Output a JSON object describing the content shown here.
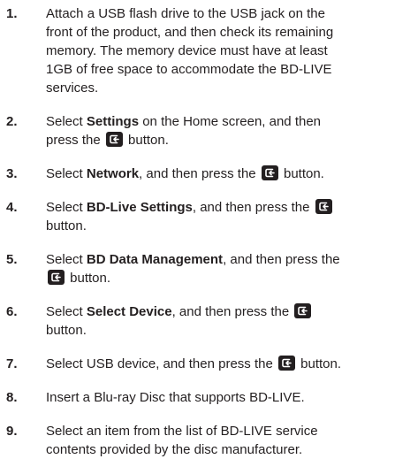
{
  "steps": [
    {
      "number": "1.",
      "segments": [
        {
          "t": "text",
          "v": "Attach a USB flash drive to the USB jack on the\nfront of the product, and then check its remaining\nmemory. The memory device must have at least\n1GB of free space to accommodate the BD-LIVE\nservices."
        }
      ]
    },
    {
      "number": "2.",
      "segments": [
        {
          "t": "text",
          "v": "Select "
        },
        {
          "t": "bold",
          "v": "Settings"
        },
        {
          "t": "text",
          "v": " on the Home screen, and then\npress the "
        },
        {
          "t": "icon",
          "v": "enter-button-icon"
        },
        {
          "t": "text",
          "v": " button."
        }
      ]
    },
    {
      "number": "3.",
      "segments": [
        {
          "t": "text",
          "v": "Select "
        },
        {
          "t": "bold",
          "v": "Network"
        },
        {
          "t": "text",
          "v": ", and then press the "
        },
        {
          "t": "icon",
          "v": "enter-button-icon"
        },
        {
          "t": "text",
          "v": " button."
        }
      ]
    },
    {
      "number": "4.",
      "segments": [
        {
          "t": "text",
          "v": "Select "
        },
        {
          "t": "bold",
          "v": "BD-Live Settings"
        },
        {
          "t": "text",
          "v": ", and then press the "
        },
        {
          "t": "icon",
          "v": "enter-button-icon"
        },
        {
          "t": "text",
          "v": "\nbutton."
        }
      ]
    },
    {
      "number": "5.",
      "segments": [
        {
          "t": "text",
          "v": "Select "
        },
        {
          "t": "bold",
          "v": "BD Data Management"
        },
        {
          "t": "text",
          "v": ", and then press the\n"
        },
        {
          "t": "icon",
          "v": "enter-button-icon"
        },
        {
          "t": "text",
          "v": " button."
        }
      ]
    },
    {
      "number": "6.",
      "segments": [
        {
          "t": "text",
          "v": "Select "
        },
        {
          "t": "bold",
          "v": "Select Device"
        },
        {
          "t": "text",
          "v": ", and then press the "
        },
        {
          "t": "icon",
          "v": "enter-button-icon"
        },
        {
          "t": "text",
          "v": "\nbutton."
        }
      ]
    },
    {
      "number": "7.",
      "segments": [
        {
          "t": "text",
          "v": "Select USB device, and then press the "
        },
        {
          "t": "icon",
          "v": "enter-button-icon"
        },
        {
          "t": "text",
          "v": " button."
        }
      ]
    },
    {
      "number": "8.",
      "segments": [
        {
          "t": "text",
          "v": "Insert a Blu-ray Disc that supports BD-LIVE."
        }
      ]
    },
    {
      "number": "9.",
      "segments": [
        {
          "t": "text",
          "v": "Select an item from the list of BD-LIVE service\ncontents provided by the disc manufacturer."
        }
      ]
    }
  ]
}
